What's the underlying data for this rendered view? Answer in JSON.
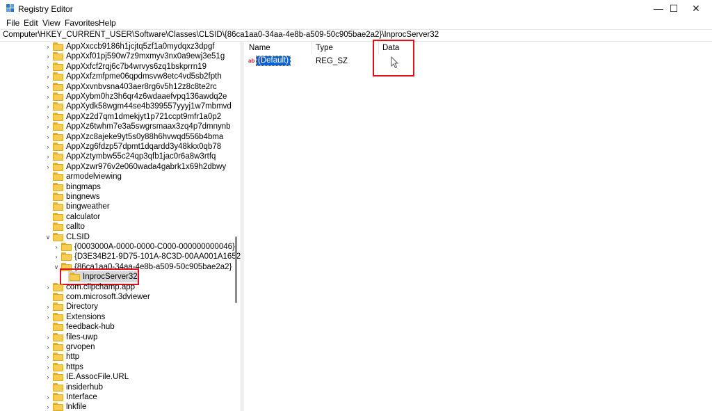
{
  "window": {
    "title": "Registry Editor",
    "minimize": "—",
    "maximize": "☐",
    "close": "✕"
  },
  "menu": [
    "File",
    "Edit",
    "View",
    "Favorites",
    "Help"
  ],
  "address": "Computer\\HKEY_CURRENT_USER\\Software\\Classes\\CLSID\\{86ca1aa0-34aa-4e8b-a509-50c905bae2a2}\\InprocServer32",
  "tree": [
    {
      "label": "AppXxccb9186h1jcjtq5zf1a0mydqxz3dpgf",
      "level": 0,
      "expander": "collapsed"
    },
    {
      "label": "AppXxf01pj590w7z9mxmyv3nx0a9ewj3e51g",
      "level": 0,
      "expander": "collapsed"
    },
    {
      "label": "AppXxfcf2rqj6c7b4wrvys6zq1bskprrn19",
      "level": 0,
      "expander": "collapsed"
    },
    {
      "label": "AppXxfzmfpme06qpdmsvw8etc4vd5sb2fpth",
      "level": 0,
      "expander": "collapsed"
    },
    {
      "label": "AppXxvnbvsna403aer8rg6v5h12z8c8te2rc",
      "level": 0,
      "expander": "collapsed"
    },
    {
      "label": "AppXybm0hz3h6qr4z6wdaaefvpq136awdq2e",
      "level": 0,
      "expander": "collapsed"
    },
    {
      "label": "AppXydk58wgm44se4b399557yyyj1w7mbmvd",
      "level": 0,
      "expander": "collapsed"
    },
    {
      "label": "AppXz2d7qm1dmekjyt1p721ccpt9mfr1a0p2",
      "level": 0,
      "expander": "collapsed"
    },
    {
      "label": "AppXz6twhm7e3a5swgrsmaax3zq4p7dmnynb",
      "level": 0,
      "expander": "collapsed"
    },
    {
      "label": "AppXzc8ajeke9yt5s0y88h6hvwqd556b4bma",
      "level": 0,
      "expander": "collapsed"
    },
    {
      "label": "AppXzg6fdzp57dpmt1dqardd3y48kkx0qb78",
      "level": 0,
      "expander": "collapsed"
    },
    {
      "label": "AppXztymbw55c24qp3qfb1jac0r6a8w3rtfq",
      "level": 0,
      "expander": "collapsed"
    },
    {
      "label": "AppXzwr976v2e060wada4gabrk1x69h2dbwy",
      "level": 0,
      "expander": "collapsed"
    },
    {
      "label": "armodelviewing",
      "level": 0,
      "expander": "none"
    },
    {
      "label": "bingmaps",
      "level": 0,
      "expander": "none"
    },
    {
      "label": "bingnews",
      "level": 0,
      "expander": "none"
    },
    {
      "label": "bingweather",
      "level": 0,
      "expander": "none"
    },
    {
      "label": "calculator",
      "level": 0,
      "expander": "none"
    },
    {
      "label": "callto",
      "level": 0,
      "expander": "none"
    },
    {
      "label": "CLSID",
      "level": 0,
      "expander": "expanded"
    },
    {
      "label": "{0003000A-0000-0000-C000-000000000046}",
      "level": 1,
      "expander": "collapsed"
    },
    {
      "label": "{D3E34B21-9D75-101A-8C3D-00AA001A1652}",
      "level": 1,
      "expander": "collapsed"
    },
    {
      "label": "{86ca1aa0-34aa-4e8b-a509-50c905bae2a2}",
      "level": 1,
      "expander": "expanded"
    },
    {
      "label": "InprocServer32",
      "level": 2,
      "expander": "none",
      "selected": true
    },
    {
      "label": "com.clipchamp.app",
      "level": 0,
      "expander": "collapsed"
    },
    {
      "label": "com.microsoft.3dviewer",
      "level": 0,
      "expander": "none"
    },
    {
      "label": "Directory",
      "level": 0,
      "expander": "collapsed"
    },
    {
      "label": "Extensions",
      "level": 0,
      "expander": "collapsed"
    },
    {
      "label": "feedback-hub",
      "level": 0,
      "expander": "none"
    },
    {
      "label": "files-uwp",
      "level": 0,
      "expander": "collapsed"
    },
    {
      "label": "grvopen",
      "level": 0,
      "expander": "collapsed"
    },
    {
      "label": "http",
      "level": 0,
      "expander": "collapsed"
    },
    {
      "label": "https",
      "level": 0,
      "expander": "collapsed"
    },
    {
      "label": "IE.AssocFile.URL",
      "level": 0,
      "expander": "collapsed"
    },
    {
      "label": "insiderhub",
      "level": 0,
      "expander": "none"
    },
    {
      "label": "Interface",
      "level": 0,
      "expander": "collapsed"
    },
    {
      "label": "lnkfile",
      "level": 0,
      "expander": "collapsed"
    }
  ],
  "columns": {
    "name": "Name",
    "type": "Type",
    "data": "Data"
  },
  "values": [
    {
      "icon": "string-value-icon",
      "icon_text": "ab",
      "name": "(Default)",
      "type": "REG_SZ",
      "data": ""
    }
  ]
}
